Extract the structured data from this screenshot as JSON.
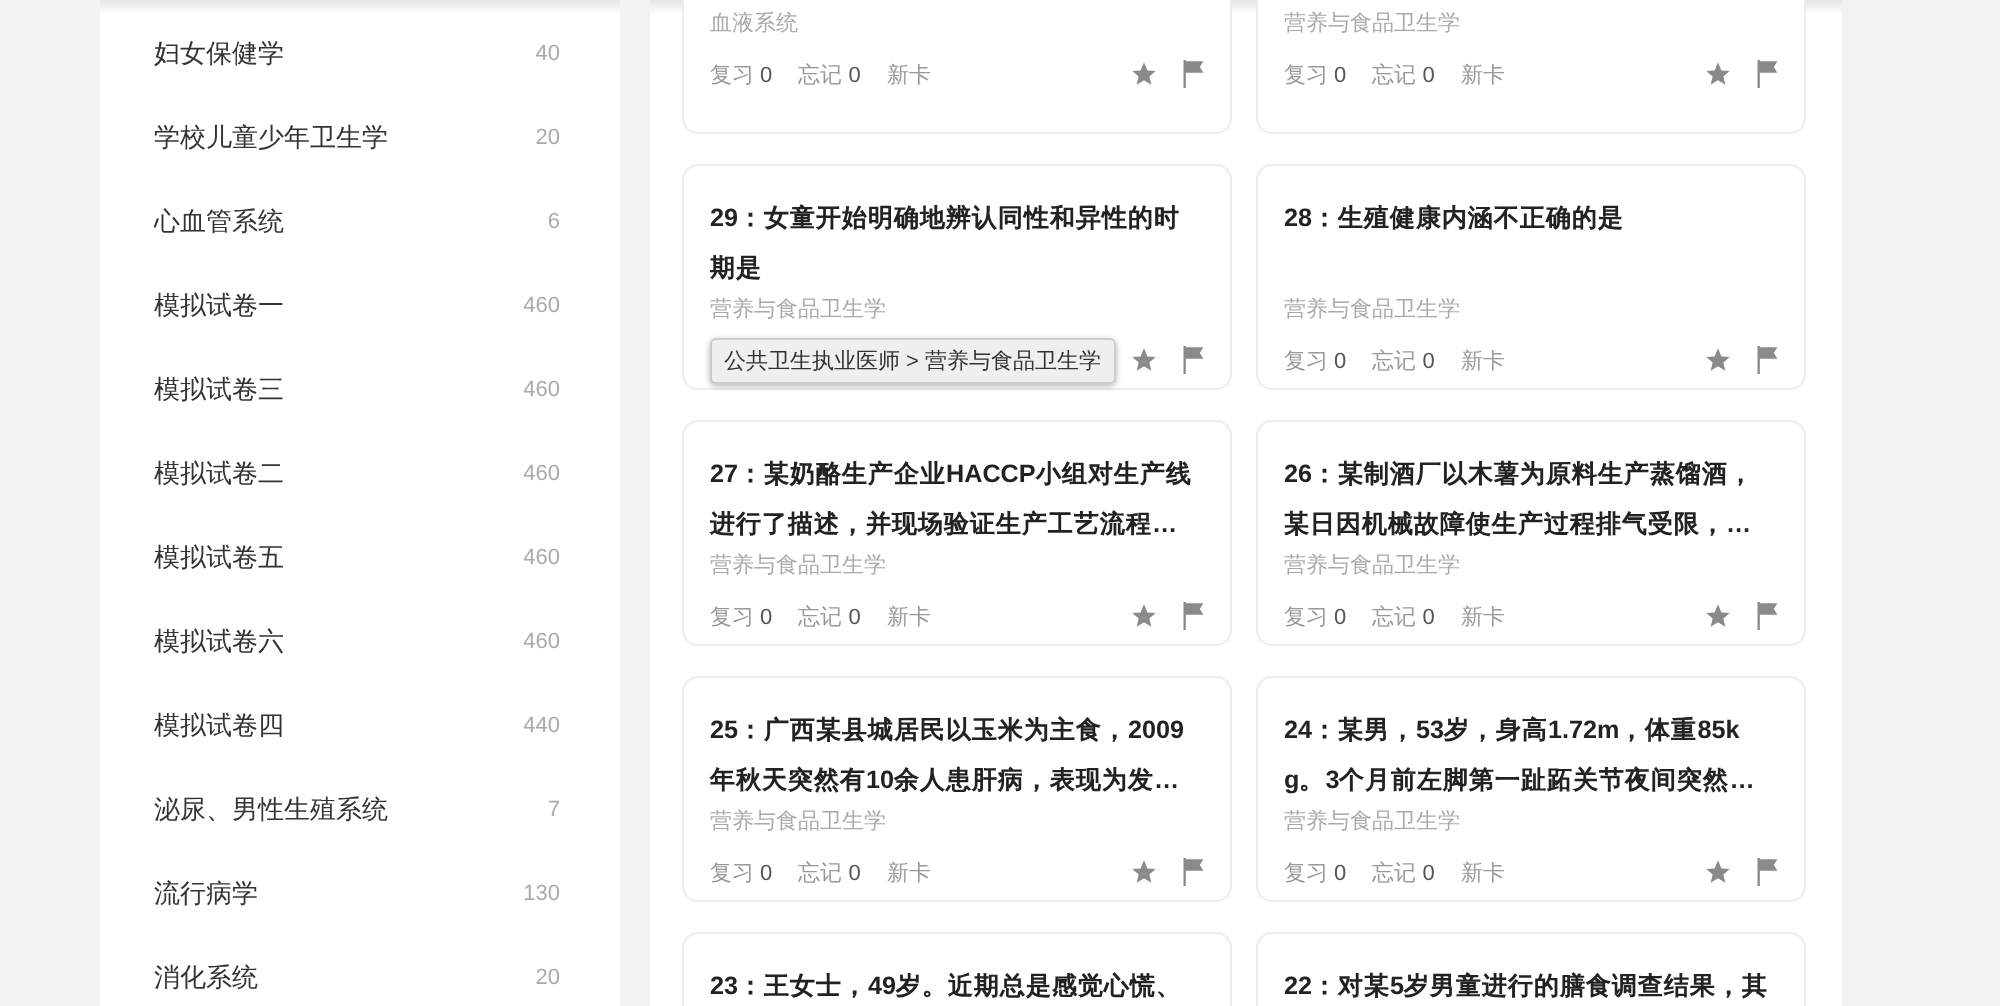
{
  "sidebar": {
    "items": [
      {
        "label": "妇女保健学",
        "count": "40"
      },
      {
        "label": "学校儿童少年卫生学",
        "count": "20"
      },
      {
        "label": "心血管系统",
        "count": "6"
      },
      {
        "label": "模拟试卷一",
        "count": "460"
      },
      {
        "label": "模拟试卷三",
        "count": "460"
      },
      {
        "label": "模拟试卷二",
        "count": "460"
      },
      {
        "label": "模拟试卷五",
        "count": "460"
      },
      {
        "label": "模拟试卷六",
        "count": "460"
      },
      {
        "label": "模拟试卷四",
        "count": "440"
      },
      {
        "label": "泌尿、男性生殖系统",
        "count": "7"
      },
      {
        "label": "流行病学",
        "count": "130"
      },
      {
        "label": "消化系统",
        "count": "20"
      }
    ]
  },
  "cards": [
    {
      "subject": "血液系统",
      "stats": [
        {
          "label": "复习",
          "count": "0"
        },
        {
          "label": "忘记",
          "count": "0"
        },
        {
          "label": "新卡"
        }
      ]
    },
    {
      "subject": "营养与食品卫生学",
      "stats": [
        {
          "label": "复习",
          "count": "0"
        },
        {
          "label": "忘记",
          "count": "0"
        },
        {
          "label": "新卡"
        }
      ]
    },
    {
      "title": "29：女童开始明确地辨认同性和异性的时期是",
      "subject": "营养与食品卫生学",
      "tooltip": "公共卫生执业医师 > 营养与食品卫生学"
    },
    {
      "title": "28：生殖健康内涵不正确的是",
      "subject": "营养与食品卫生学",
      "stats": [
        {
          "label": "复习",
          "count": "0"
        },
        {
          "label": "忘记",
          "count": "0"
        },
        {
          "label": "新卡"
        }
      ]
    },
    {
      "title": "27：某奶酪生产企业HACCP小组对生产线进行了描述，并现场验证生产工艺流程…",
      "subject": "营养与食品卫生学",
      "stats": [
        {
          "label": "复习",
          "count": "0"
        },
        {
          "label": "忘记",
          "count": "0"
        },
        {
          "label": "新卡"
        }
      ]
    },
    {
      "title": "26：某制酒厂以木薯为原料生产蒸馏酒，某日因机械故障使生产过程排气受限，…",
      "subject": "营养与食品卫生学",
      "stats": [
        {
          "label": "复习",
          "count": "0"
        },
        {
          "label": "忘记",
          "count": "0"
        },
        {
          "label": "新卡"
        }
      ]
    },
    {
      "title": "25：广西某县城居民以玉米为主食，2009年秋天突然有10余人患肝病，表现为发…",
      "subject": "营养与食品卫生学",
      "stats": [
        {
          "label": "复习",
          "count": "0"
        },
        {
          "label": "忘记",
          "count": "0"
        },
        {
          "label": "新卡"
        }
      ]
    },
    {
      "title": "24：某男，53岁，身高1.72m，体重85kg。3个月前左脚第一趾跖关节夜间突然…",
      "subject": "营养与食品卫生学",
      "stats": [
        {
          "label": "复习",
          "count": "0"
        },
        {
          "label": "忘记",
          "count": "0"
        },
        {
          "label": "新卡"
        }
      ]
    },
    {
      "title": "23：王女士，49岁。近期总是感觉心慌、"
    },
    {
      "title": "22：对某5岁男童进行的膳食调查结果，其"
    }
  ]
}
